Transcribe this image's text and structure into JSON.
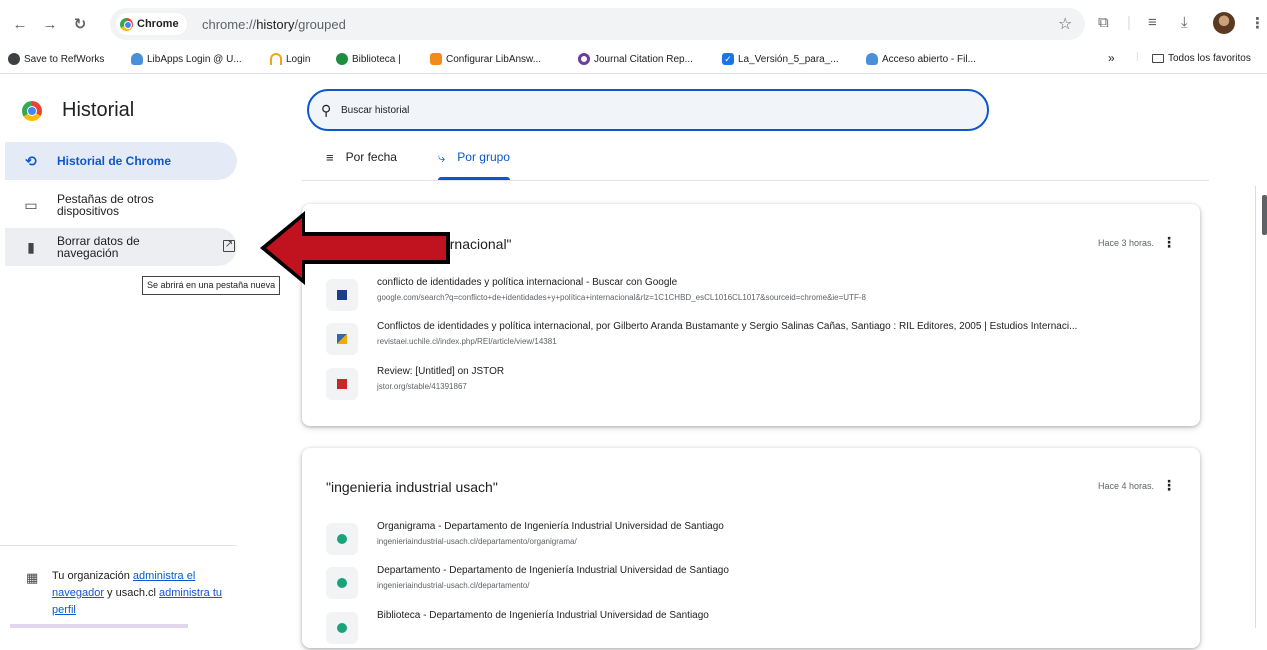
{
  "browser": {
    "chip_label": "Chrome",
    "url_scheme": "chrome://",
    "url_host": "history",
    "url_path": "/grouped"
  },
  "bookmarks": [
    {
      "label": "Save to RefWorks",
      "icon": "refworks-icon",
      "color": "#3c4043"
    },
    {
      "label": "LibApps Login @ U...",
      "icon": "cloud-icon",
      "color": "#4a90d9"
    },
    {
      "label": "Login",
      "icon": "login-icon",
      "color": "#f4a21b"
    },
    {
      "label": "Biblioteca |",
      "icon": "biblioteca-icon",
      "color": "#1e8e3e"
    },
    {
      "label": "Configurar LibAnsw...",
      "icon": "libanswers-icon",
      "color": "#f28b1c"
    },
    {
      "label": "Journal Citation Rep...",
      "icon": "jcr-icon",
      "color": "#6a3d9a"
    },
    {
      "label": "La_Versión_5_para_...",
      "icon": "checkbox-icon",
      "color": "#1a73e8"
    },
    {
      "label": "Acceso abierto - Fil...",
      "icon": "cloud-icon",
      "color": "#4a90d9"
    }
  ],
  "bookmarks_more": "»",
  "all_bookmarks": "Todos los favoritos",
  "sidebar": {
    "title": "Historial",
    "items": [
      {
        "label": "Historial de Chrome",
        "icon": "history-icon"
      },
      {
        "label": "Pestañas de otros dispositivos",
        "icon": "devices-icon"
      },
      {
        "label": "Borrar datos de navegación",
        "icon": "trash-icon"
      }
    ],
    "tooltip": "Se abrirá en una pestaña nueva",
    "org_prefix": "Tu organización ",
    "org_link1": "administra el navegador",
    "org_middle": " y usach.cl ",
    "org_link2": "administra tu perfil"
  },
  "search": {
    "placeholder": "Buscar historial"
  },
  "tabs": [
    {
      "label": "Por fecha",
      "icon": "list-icon",
      "active": false
    },
    {
      "label": "Por grupo",
      "icon": "group-icon",
      "active": true
    }
  ],
  "groups": [
    {
      "title": "dades y política internacional\"",
      "time": "Hace 3 horas.",
      "items": [
        {
          "title": "conflicto de identidades y política internacional - Buscar con Google",
          "url": "google.com/search?q=conflicto+de+identidades+y+política+internacional&rlz=1C1CHBD_esCL1016CL1017&sourceid=chrome&ie=UTF-8",
          "favicon_color": "#1a3d8f"
        },
        {
          "title": "Conflictos de identidades y política internacional, por Gilberto Aranda Bustamante y Sergio Salinas Cañas, Santiago : RIL Editores, 2005 | Estudios Internaci...",
          "url": "revistaei.uchile.cl/index.php/REI/article/view/14381",
          "favicon_color": "#2b6cb0"
        },
        {
          "title": "Review: [Untitled] on JSTOR",
          "url": "jstor.org/stable/41391867",
          "favicon_color": "#c62828"
        }
      ]
    },
    {
      "title": "\"ingenieria industrial usach\"",
      "time": "Hace 4 horas.",
      "items": [
        {
          "title": "Organigrama - Departamento de Ingeniería Industrial Universidad de Santiago",
          "url": "ingenieriaindustrial-usach.cl/departamento/organigrama/",
          "favicon_color": "#1aa37a"
        },
        {
          "title": "Departamento - Departamento de Ingeniería Industrial Universidad de Santiago",
          "url": "ingenieriaindustrial-usach.cl/departamento/",
          "favicon_color": "#1aa37a"
        },
        {
          "title": "Biblioteca - Departamento de Ingeniería Industrial Universidad de Santiago",
          "url": "",
          "favicon_color": "#1aa37a"
        }
      ]
    }
  ],
  "annotation_arrow_color": "#c1121f"
}
